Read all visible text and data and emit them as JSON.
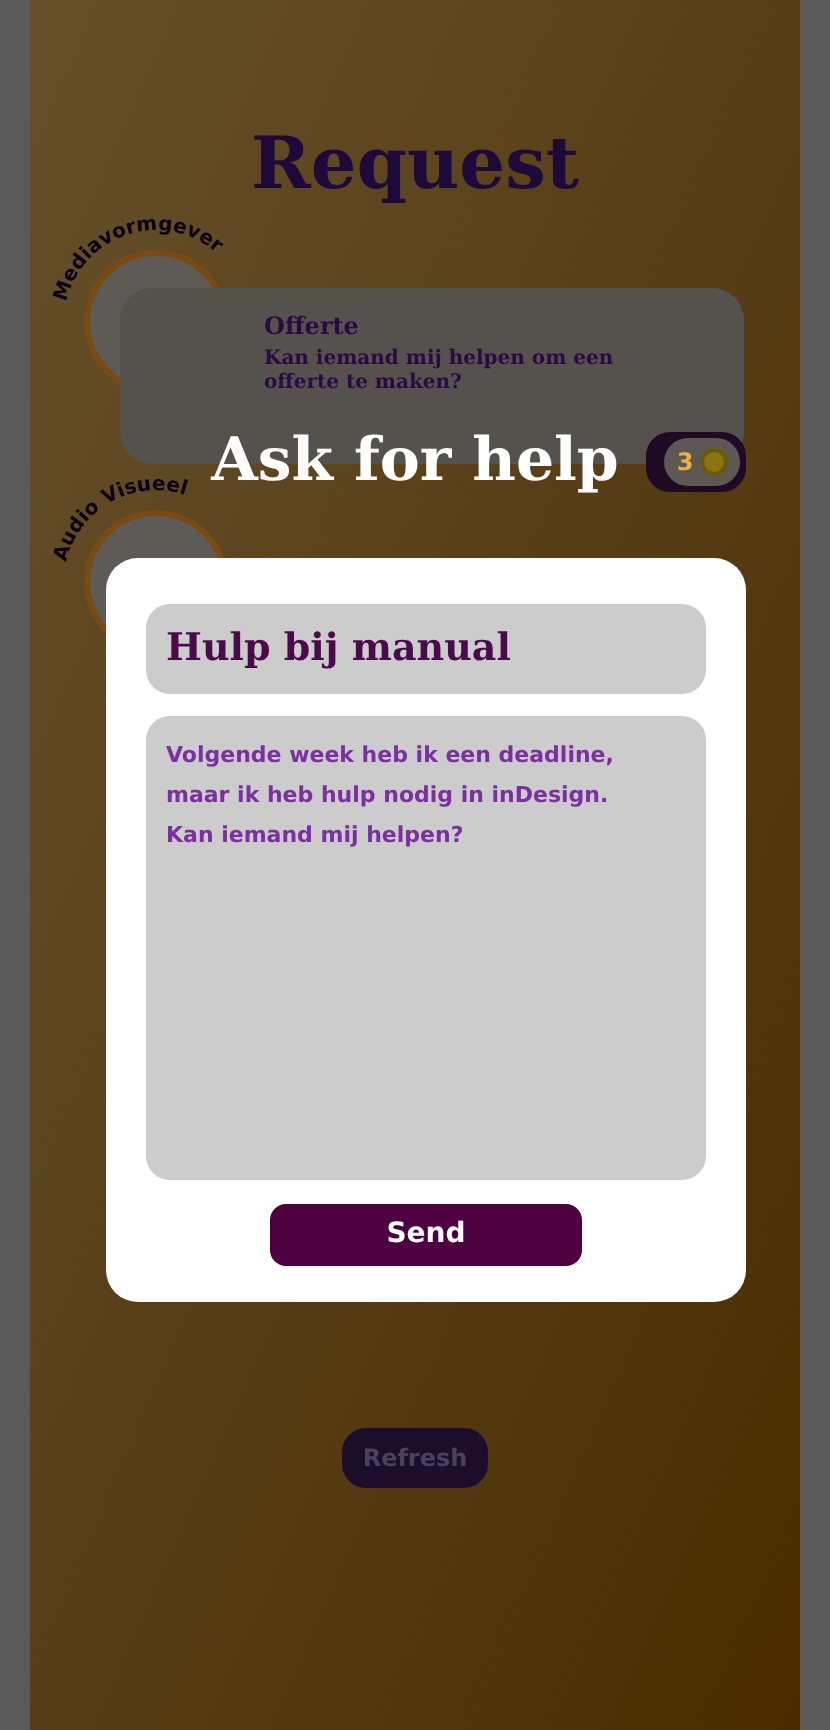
{
  "page": {
    "title": "Request",
    "requests": [
      {
        "role": "Mediavormgever",
        "title": "Offerte",
        "message": "Kan iemand mij helpen om een offerte te maken?",
        "count": "3"
      },
      {
        "role": "Audio Visueel"
      }
    ],
    "refresh": "Refresh"
  },
  "dialog": {
    "heading": "Ask for help",
    "subject": "Hulp bij manual",
    "message": "Volgende week heb ik een deadline,\nmaar ik heb hulp nodig in inDesign.\nKan iemand mij helpen?",
    "send": "Send"
  }
}
